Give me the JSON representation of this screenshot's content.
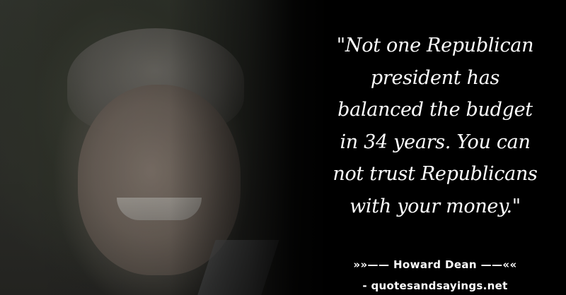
{
  "quote": {
    "lines": [
      "\"Not one Republican",
      "president has",
      "balanced the budget",
      "in 34 years. You can",
      "not trust Republicans",
      "with your money.\""
    ]
  },
  "attribution": {
    "author_line": "»»—— Howard Dean ——««",
    "source_line": "- quotesandsayings.net"
  },
  "colors": {
    "background": "#000000",
    "text": "#ffffff"
  }
}
